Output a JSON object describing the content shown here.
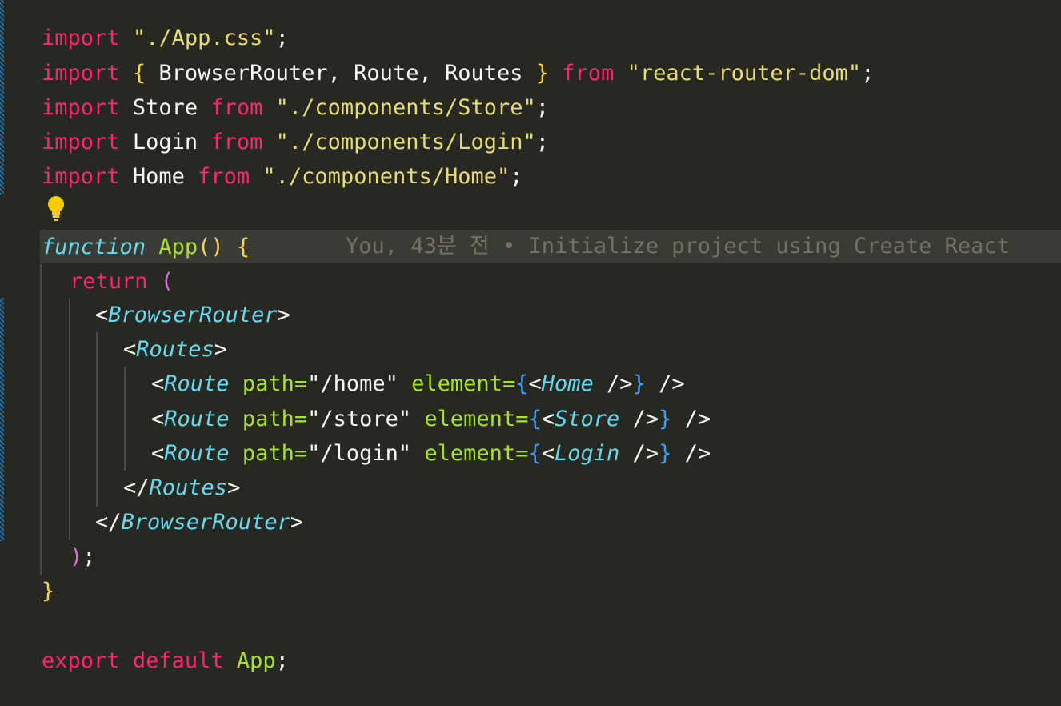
{
  "editor": {
    "lines": {
      "l1": {
        "kw": "import",
        "str": "\"./App.css\"",
        "end": ";"
      },
      "l2": {
        "kw": "import",
        "ob": "{",
        "names": "BrowserRouter, Route, Routes",
        "cb": "}",
        "from": "from",
        "str": "\"react-router-dom\"",
        "end": ";"
      },
      "l3": {
        "kw": "import",
        "name": "Store",
        "from": "from",
        "str": "\"./components/Store\"",
        "end": ";"
      },
      "l4": {
        "kw": "import",
        "name": "Login",
        "from": "from",
        "str": "\"./components/Login\"",
        "end": ";"
      },
      "l5": {
        "kw": "import",
        "name": "Home",
        "from": "from",
        "str": "\"./components/Home\"",
        "end": ";"
      },
      "l7": {
        "kw": "function",
        "name": "App",
        "parens": "()",
        "ob": "{"
      },
      "l8": {
        "kw": "return",
        "paren": "("
      },
      "l9": {
        "lt": "<",
        "tag": "BrowserRouter",
        "gt": ">"
      },
      "l10": {
        "lt": "<",
        "tag": "Routes",
        "gt": ">"
      },
      "l11": {
        "lt": "<",
        "tag": "Route",
        "attr1": "path=",
        "val1": "\"/home\"",
        "attr2": "element=",
        "ob": "{",
        "ilt": "<",
        "itag": "Home",
        "iclose": " />",
        "cb": "}",
        "close": " />"
      },
      "l12": {
        "lt": "<",
        "tag": "Route",
        "attr1": "path=",
        "val1": "\"/store\"",
        "attr2": "element=",
        "ob": "{",
        "ilt": "<",
        "itag": "Store",
        "iclose": " />",
        "cb": "}",
        "close": " />"
      },
      "l13": {
        "lt": "<",
        "tag": "Route",
        "attr1": "path=",
        "val1": "\"/login\"",
        "attr2": "element=",
        "ob": "{",
        "ilt": "<",
        "itag": "Login",
        "iclose": " />",
        "cb": "}",
        "close": " />"
      },
      "l14": {
        "lt": "</",
        "tag": "Routes",
        "gt": ">"
      },
      "l15": {
        "lt": "</",
        "tag": "BrowserRouter",
        "gt": ">"
      },
      "l16": {
        "paren": ")",
        "end": ";"
      },
      "l17": {
        "cb": "}"
      },
      "l19": {
        "kw1": "export",
        "kw2": "default",
        "name": "App",
        "end": ";"
      }
    },
    "blame": "You, 43분 전 • Initialize project using Create React",
    "colors": {
      "background": "#272822",
      "keyword": "#f92672",
      "string": "#e6db74",
      "function": "#a6e22e",
      "tag": "#66d9ef"
    }
  }
}
